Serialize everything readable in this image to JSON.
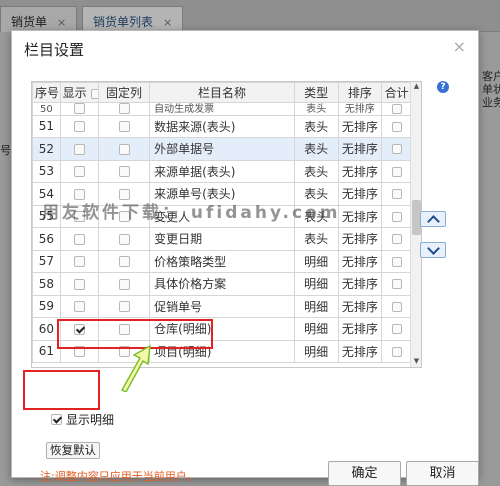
{
  "background": {
    "tabs": [
      {
        "label": "销货单",
        "close": "×"
      },
      {
        "label": "销货单列表",
        "close": "×"
      }
    ],
    "side_right_text": "客户\n单状\n业务员",
    "side_left_text": "号"
  },
  "dialog": {
    "title": "栏目设置",
    "close": "×",
    "help": "?",
    "grid": {
      "headers": [
        "序号",
        "显示",
        "固定列",
        "栏目名称",
        "类型",
        "排序",
        "合计"
      ],
      "partial_row": {
        "no": "50",
        "name": "自动生成发票",
        "type": "表头",
        "sort": "无排序"
      },
      "rows": [
        {
          "no": "51",
          "show": false,
          "name": "数据来源(表头)",
          "type": "表头",
          "sort": "无排序"
        },
        {
          "no": "52",
          "show": false,
          "name": "外部单据号",
          "type": "表头",
          "sort": "无排序"
        },
        {
          "no": "53",
          "show": false,
          "name": "来源单据(表头)",
          "type": "表头",
          "sort": "无排序"
        },
        {
          "no": "54",
          "show": false,
          "name": "来源单号(表头)",
          "type": "表头",
          "sort": "无排序"
        },
        {
          "no": "55",
          "show": false,
          "name": "变更人",
          "type": "表头",
          "sort": "无排序"
        },
        {
          "no": "56",
          "show": false,
          "name": "变更日期",
          "type": "表头",
          "sort": "无排序"
        },
        {
          "no": "57",
          "show": false,
          "name": "价格策略类型",
          "type": "明细",
          "sort": "无排序"
        },
        {
          "no": "58",
          "show": false,
          "name": "具体价格方案",
          "type": "明细",
          "sort": "无排序"
        },
        {
          "no": "59",
          "show": false,
          "name": "促销单号",
          "type": "明细",
          "sort": "无排序"
        },
        {
          "no": "60",
          "show": true,
          "name": "仓库(明细)",
          "type": "明细",
          "sort": "无排序"
        },
        {
          "no": "61",
          "show": false,
          "name": "项目(明细)",
          "type": "明细",
          "sort": "无排序"
        }
      ]
    },
    "watermark": "用友软件下载： ufidahy.com",
    "show_detail_label": "显示明细",
    "show_detail_checked": true,
    "restore_label": "恢复默认",
    "note": "注:调整内容只应用于当前用户。",
    "ok_label": "确定",
    "cancel_label": "取消"
  },
  "colors": {
    "annotation_red": "#e22323",
    "note_orange": "#e45b1f",
    "highlight_row": "#e4eefb"
  }
}
